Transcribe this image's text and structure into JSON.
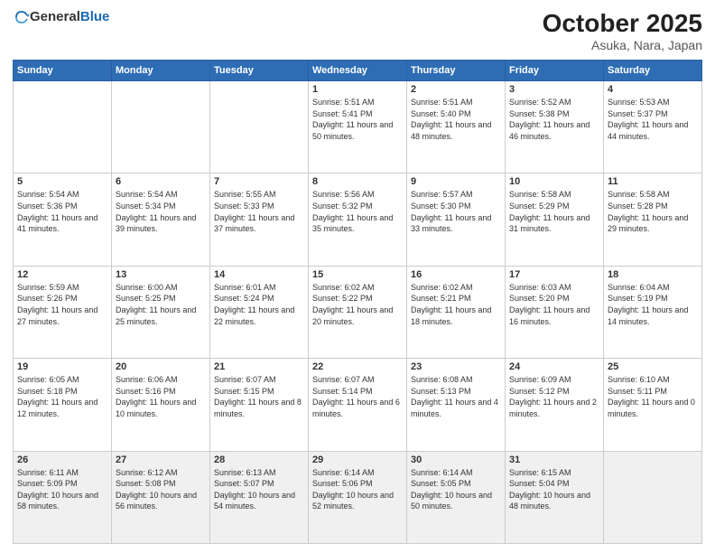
{
  "header": {
    "logo_general": "General",
    "logo_blue": "Blue",
    "month": "October 2025",
    "location": "Asuka, Nara, Japan"
  },
  "weekdays": [
    "Sunday",
    "Monday",
    "Tuesday",
    "Wednesday",
    "Thursday",
    "Friday",
    "Saturday"
  ],
  "weeks": [
    [
      {
        "day": "",
        "sunrise": "",
        "sunset": "",
        "daylight": ""
      },
      {
        "day": "",
        "sunrise": "",
        "sunset": "",
        "daylight": ""
      },
      {
        "day": "",
        "sunrise": "",
        "sunset": "",
        "daylight": ""
      },
      {
        "day": "1",
        "sunrise": "Sunrise: 5:51 AM",
        "sunset": "Sunset: 5:41 PM",
        "daylight": "Daylight: 11 hours and 50 minutes."
      },
      {
        "day": "2",
        "sunrise": "Sunrise: 5:51 AM",
        "sunset": "Sunset: 5:40 PM",
        "daylight": "Daylight: 11 hours and 48 minutes."
      },
      {
        "day": "3",
        "sunrise": "Sunrise: 5:52 AM",
        "sunset": "Sunset: 5:38 PM",
        "daylight": "Daylight: 11 hours and 46 minutes."
      },
      {
        "day": "4",
        "sunrise": "Sunrise: 5:53 AM",
        "sunset": "Sunset: 5:37 PM",
        "daylight": "Daylight: 11 hours and 44 minutes."
      }
    ],
    [
      {
        "day": "5",
        "sunrise": "Sunrise: 5:54 AM",
        "sunset": "Sunset: 5:36 PM",
        "daylight": "Daylight: 11 hours and 41 minutes."
      },
      {
        "day": "6",
        "sunrise": "Sunrise: 5:54 AM",
        "sunset": "Sunset: 5:34 PM",
        "daylight": "Daylight: 11 hours and 39 minutes."
      },
      {
        "day": "7",
        "sunrise": "Sunrise: 5:55 AM",
        "sunset": "Sunset: 5:33 PM",
        "daylight": "Daylight: 11 hours and 37 minutes."
      },
      {
        "day": "8",
        "sunrise": "Sunrise: 5:56 AM",
        "sunset": "Sunset: 5:32 PM",
        "daylight": "Daylight: 11 hours and 35 minutes."
      },
      {
        "day": "9",
        "sunrise": "Sunrise: 5:57 AM",
        "sunset": "Sunset: 5:30 PM",
        "daylight": "Daylight: 11 hours and 33 minutes."
      },
      {
        "day": "10",
        "sunrise": "Sunrise: 5:58 AM",
        "sunset": "Sunset: 5:29 PM",
        "daylight": "Daylight: 11 hours and 31 minutes."
      },
      {
        "day": "11",
        "sunrise": "Sunrise: 5:58 AM",
        "sunset": "Sunset: 5:28 PM",
        "daylight": "Daylight: 11 hours and 29 minutes."
      }
    ],
    [
      {
        "day": "12",
        "sunrise": "Sunrise: 5:59 AM",
        "sunset": "Sunset: 5:26 PM",
        "daylight": "Daylight: 11 hours and 27 minutes."
      },
      {
        "day": "13",
        "sunrise": "Sunrise: 6:00 AM",
        "sunset": "Sunset: 5:25 PM",
        "daylight": "Daylight: 11 hours and 25 minutes."
      },
      {
        "day": "14",
        "sunrise": "Sunrise: 6:01 AM",
        "sunset": "Sunset: 5:24 PM",
        "daylight": "Daylight: 11 hours and 22 minutes."
      },
      {
        "day": "15",
        "sunrise": "Sunrise: 6:02 AM",
        "sunset": "Sunset: 5:22 PM",
        "daylight": "Daylight: 11 hours and 20 minutes."
      },
      {
        "day": "16",
        "sunrise": "Sunrise: 6:02 AM",
        "sunset": "Sunset: 5:21 PM",
        "daylight": "Daylight: 11 hours and 18 minutes."
      },
      {
        "day": "17",
        "sunrise": "Sunrise: 6:03 AM",
        "sunset": "Sunset: 5:20 PM",
        "daylight": "Daylight: 11 hours and 16 minutes."
      },
      {
        "day": "18",
        "sunrise": "Sunrise: 6:04 AM",
        "sunset": "Sunset: 5:19 PM",
        "daylight": "Daylight: 11 hours and 14 minutes."
      }
    ],
    [
      {
        "day": "19",
        "sunrise": "Sunrise: 6:05 AM",
        "sunset": "Sunset: 5:18 PM",
        "daylight": "Daylight: 11 hours and 12 minutes."
      },
      {
        "day": "20",
        "sunrise": "Sunrise: 6:06 AM",
        "sunset": "Sunset: 5:16 PM",
        "daylight": "Daylight: 11 hours and 10 minutes."
      },
      {
        "day": "21",
        "sunrise": "Sunrise: 6:07 AM",
        "sunset": "Sunset: 5:15 PM",
        "daylight": "Daylight: 11 hours and 8 minutes."
      },
      {
        "day": "22",
        "sunrise": "Sunrise: 6:07 AM",
        "sunset": "Sunset: 5:14 PM",
        "daylight": "Daylight: 11 hours and 6 minutes."
      },
      {
        "day": "23",
        "sunrise": "Sunrise: 6:08 AM",
        "sunset": "Sunset: 5:13 PM",
        "daylight": "Daylight: 11 hours and 4 minutes."
      },
      {
        "day": "24",
        "sunrise": "Sunrise: 6:09 AM",
        "sunset": "Sunset: 5:12 PM",
        "daylight": "Daylight: 11 hours and 2 minutes."
      },
      {
        "day": "25",
        "sunrise": "Sunrise: 6:10 AM",
        "sunset": "Sunset: 5:11 PM",
        "daylight": "Daylight: 11 hours and 0 minutes."
      }
    ],
    [
      {
        "day": "26",
        "sunrise": "Sunrise: 6:11 AM",
        "sunset": "Sunset: 5:09 PM",
        "daylight": "Daylight: 10 hours and 58 minutes."
      },
      {
        "day": "27",
        "sunrise": "Sunrise: 6:12 AM",
        "sunset": "Sunset: 5:08 PM",
        "daylight": "Daylight: 10 hours and 56 minutes."
      },
      {
        "day": "28",
        "sunrise": "Sunrise: 6:13 AM",
        "sunset": "Sunset: 5:07 PM",
        "daylight": "Daylight: 10 hours and 54 minutes."
      },
      {
        "day": "29",
        "sunrise": "Sunrise: 6:14 AM",
        "sunset": "Sunset: 5:06 PM",
        "daylight": "Daylight: 10 hours and 52 minutes."
      },
      {
        "day": "30",
        "sunrise": "Sunrise: 6:14 AM",
        "sunset": "Sunset: 5:05 PM",
        "daylight": "Daylight: 10 hours and 50 minutes."
      },
      {
        "day": "31",
        "sunrise": "Sunrise: 6:15 AM",
        "sunset": "Sunset: 5:04 PM",
        "daylight": "Daylight: 10 hours and 48 minutes."
      },
      {
        "day": "",
        "sunrise": "",
        "sunset": "",
        "daylight": ""
      }
    ]
  ]
}
